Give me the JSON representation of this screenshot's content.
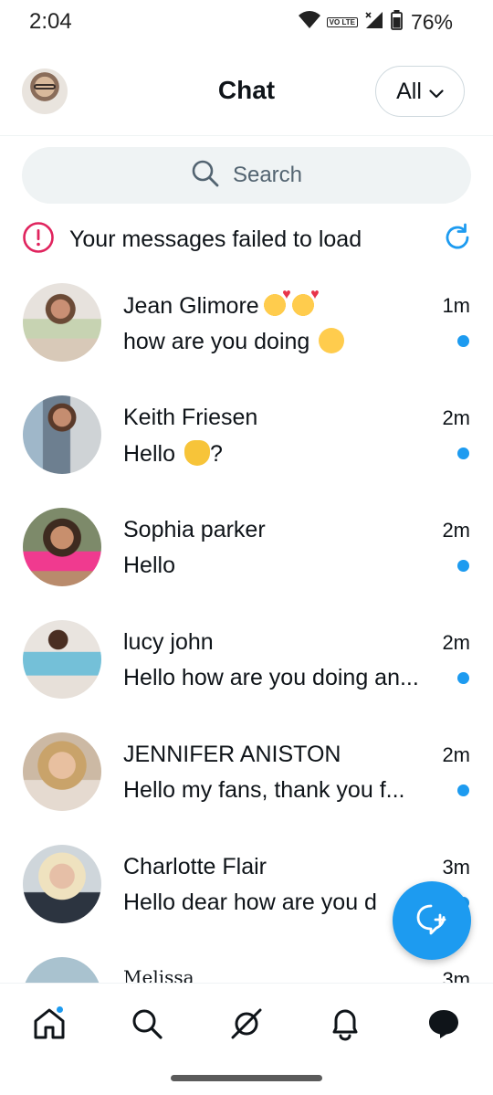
{
  "status_bar": {
    "time": "2:04",
    "battery": "76%",
    "network_badge": "VO LTE"
  },
  "header": {
    "title": "Chat",
    "filter_label": "All"
  },
  "search": {
    "placeholder": "Search"
  },
  "error": {
    "message": "Your messages failed to load"
  },
  "chats": [
    {
      "name": "Jean Glimore",
      "name_emoji": "smiling-face-with-hearts x2",
      "time": "1m",
      "preview": "how are you doing",
      "preview_emoji": "smiling-face",
      "unread": true
    },
    {
      "name": "Keith Friesen",
      "time": "2m",
      "preview": "Hello",
      "preview_suffix": "?",
      "preview_emoji": "waving-hand",
      "unread": true
    },
    {
      "name": "Sophia parker",
      "time": "2m",
      "preview": "Hello",
      "unread": true
    },
    {
      "name": "lucy john",
      "time": "2m",
      "preview": "Hello how are you doing an...",
      "unread": true
    },
    {
      "name": "JENNIFER ANISTON",
      "time": "2m",
      "preview": "Hello my fans, thank you  f...",
      "unread": true
    },
    {
      "name": "Charlotte Flair",
      "time": "3m",
      "preview": "Hello dear how are you d",
      "unread": true
    },
    {
      "name": "Melissa",
      "time": "3m",
      "preview": "",
      "unread": false
    }
  ],
  "nav": [
    "home-icon",
    "search-icon",
    "grok-icon",
    "notifications-icon",
    "messages-icon"
  ],
  "colors": {
    "accent": "#1d9bf0",
    "error": "#e0245e",
    "text": "#0f1419",
    "muted": "#536471"
  }
}
